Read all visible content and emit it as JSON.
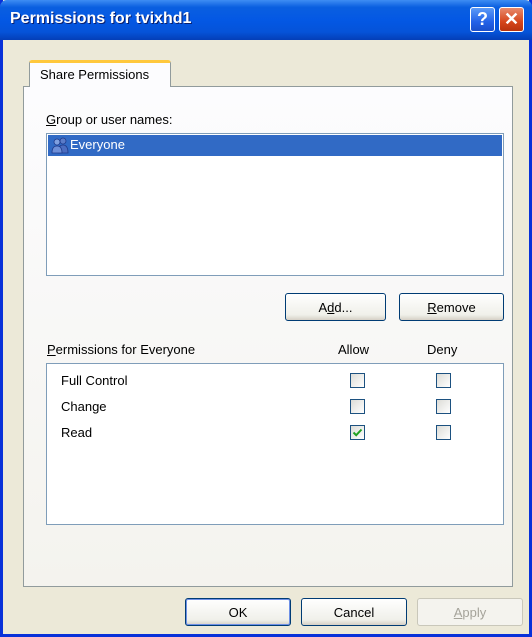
{
  "window": {
    "title": "Permissions for tvixhd1",
    "help_button": "?",
    "close_button": "✕"
  },
  "tabs": [
    {
      "label": "Share Permissions",
      "active": true
    }
  ],
  "group_section": {
    "label_prefix": "",
    "label_mnemonic": "G",
    "label_rest": "roup or user names:",
    "users": [
      {
        "name": "Everyone",
        "selected": true,
        "icon": "users-group-icon"
      }
    ]
  },
  "buttons": {
    "add": {
      "pre": "A",
      "mn": "d",
      "post": "d..."
    },
    "remove": {
      "pre": "",
      "mn": "R",
      "post": "emove"
    }
  },
  "permissions": {
    "header_mnemonic": "P",
    "header_rest": "ermissions for Everyone",
    "allow_label": "Allow",
    "deny_label": "Deny",
    "rows": [
      {
        "name": "Full Control",
        "allow": false,
        "deny": false
      },
      {
        "name": "Change",
        "allow": false,
        "deny": false
      },
      {
        "name": "Read",
        "allow": true,
        "deny": false
      }
    ]
  },
  "footer": {
    "ok": "OK",
    "cancel": "Cancel",
    "apply_mnemonic": "A",
    "apply_rest": "pply"
  },
  "colors": {
    "title_bar": "#0458E4",
    "selection": "#316AC5",
    "check_mark": "#21A121",
    "dialog_bg": "#ECE9D8"
  }
}
